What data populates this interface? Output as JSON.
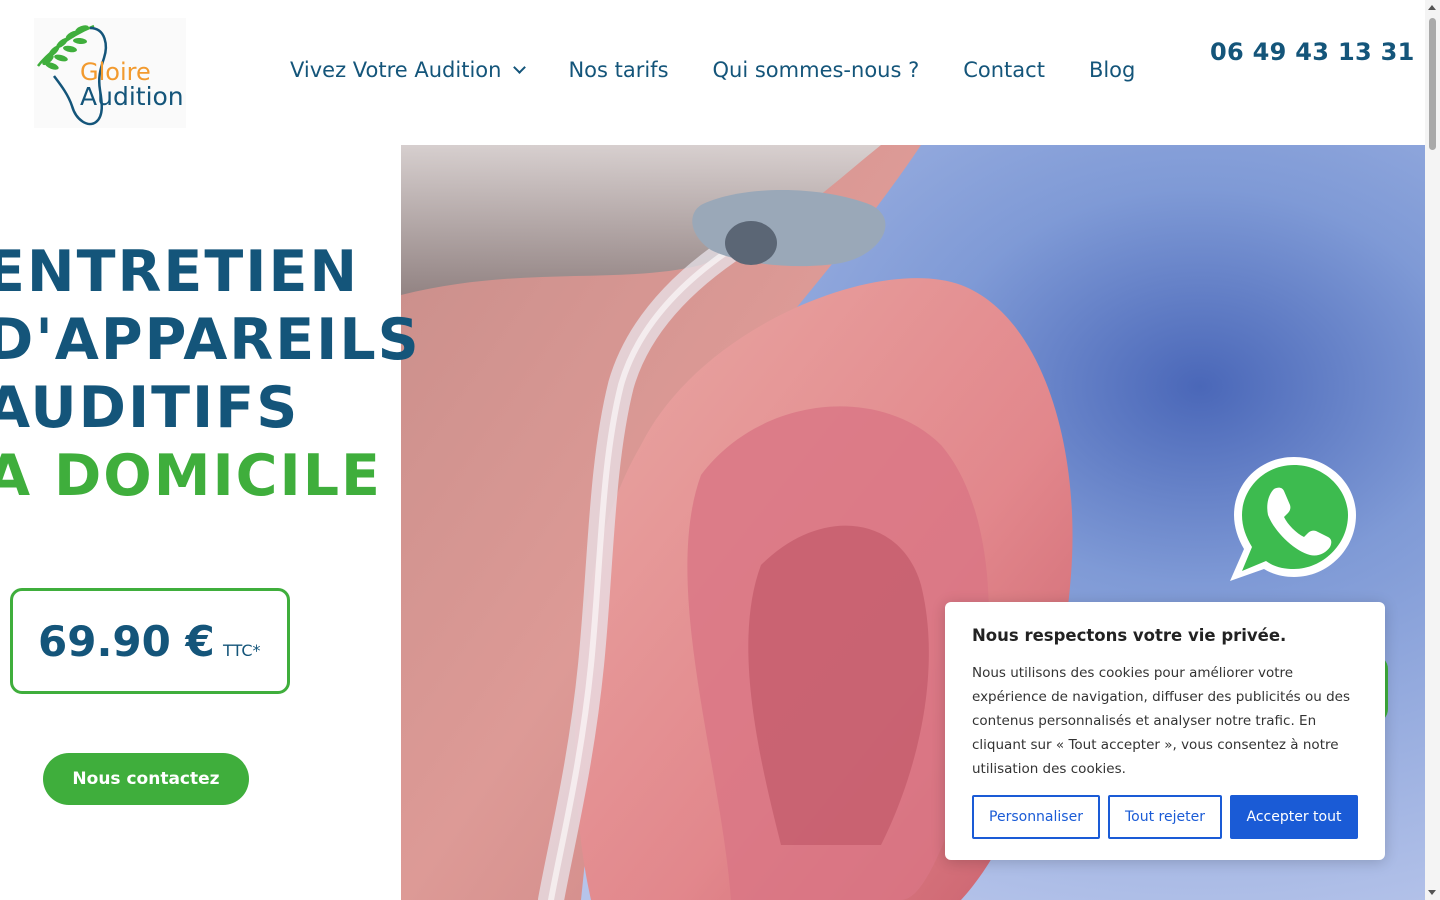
{
  "header": {
    "logo": {
      "line1": "Gloire",
      "line2": "Audition"
    },
    "nav": [
      {
        "label": "Vivez Votre Audition",
        "has_dropdown": true
      },
      {
        "label": "Nos tarifs"
      },
      {
        "label": "Qui sommes-nous ?"
      },
      {
        "label": "Contact"
      },
      {
        "label": "Blog"
      }
    ],
    "phone": "06 49 43 13 31"
  },
  "hero": {
    "headline_lines": [
      "ENTRETIEN",
      "D'APPAREILS",
      "AUDITIFS"
    ],
    "headline_accent": "A DOMICILE",
    "price": "69.90 €",
    "price_suffix": "TTC*",
    "cta_label": "Nous contactez"
  },
  "whatsapp": {
    "icon": "whatsapp-icon"
  },
  "cookie_banner": {
    "title": "Nous respectons votre vie privée.",
    "text": "Nous utilisons des cookies pour améliorer votre expérience de navigation, diffuser des publicités ou des contenus personnalisés et analyser notre trafic. En cliquant sur « Tout accepter », vous consentez à notre utilisation des cookies.",
    "buttons": {
      "customize": "Personnaliser",
      "reject": "Tout rejeter",
      "accept": "Accepter tout"
    }
  },
  "colors": {
    "primary": "#14557a",
    "accent_green": "#3fae3c",
    "accent_orange": "#f29a2e",
    "cookie_blue": "#1a5bd6"
  }
}
